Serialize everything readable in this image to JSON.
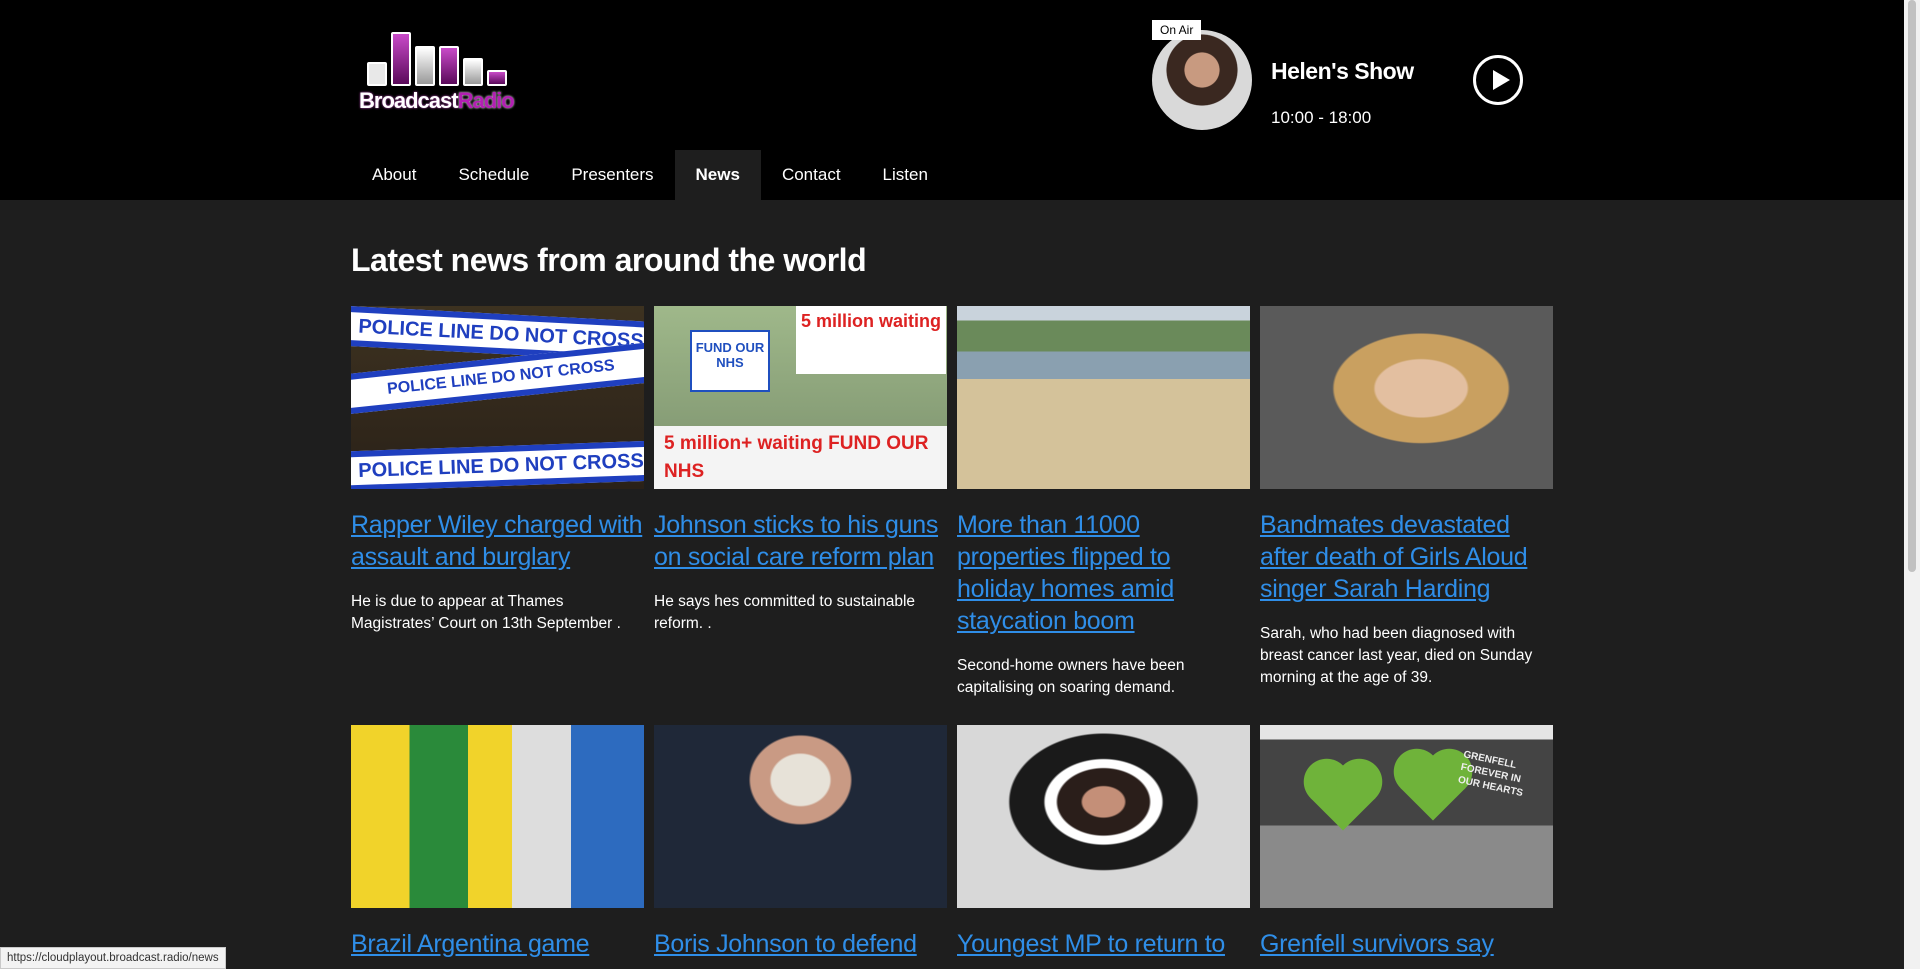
{
  "brand": {
    "logo_word_1": "Broadcast",
    "logo_word_2": "Radio",
    "accent": "#b31fb3"
  },
  "now_playing": {
    "badge": "On Air",
    "show": "Helen's Show",
    "time": "10:00 - 18:00"
  },
  "nav": [
    "About",
    "Schedule",
    "Presenters",
    "News",
    "Contact",
    "Listen"
  ],
  "nav_active": "News",
  "page": {
    "heading": "Latest news from around the world"
  },
  "articles": [
    {
      "title": "Rapper Wiley charged with assault and burglary",
      "desc": "He is due to appear at Thames Magistrates’ Court on 13th September ."
    },
    {
      "title": "Johnson sticks to his guns on social care reform plan",
      "desc": "He says hes committed to sustainable reform. ."
    },
    {
      "title": "More than 11000 properties flipped to holiday homes amid staycation boom",
      "desc": "Second-home owners have been capitalising on soaring demand."
    },
    {
      "title": "Bandmates devastated after death of Girls Aloud singer Sarah Harding",
      "desc": "Sarah, who had been diagnosed with breast cancer last year, died on Sunday morning at the age of 39."
    },
    {
      "title": "Brazil Argentina game",
      "desc": ""
    },
    {
      "title": "Boris Johnson to defend",
      "desc": ""
    },
    {
      "title": "Youngest MP to return to",
      "desc": ""
    },
    {
      "title": "Grenfell survivors say",
      "desc": ""
    }
  ],
  "image_text": {
    "tape": "POLICE LINE DO NOT CROSS",
    "sign_top": "5 million waiting",
    "sign_fund": "FUND OUR NHS",
    "banner": "5 million+ waiting FUND OUR NHS",
    "grenfell": "GRENFELL FOREVER IN OUR HEARTS"
  },
  "status_url": "https://cloudplayout.broadcast.radio/news",
  "colors": {
    "link": "#2f8ee8",
    "header_bg": "#000000",
    "page_bg": "#1e1e1e"
  }
}
